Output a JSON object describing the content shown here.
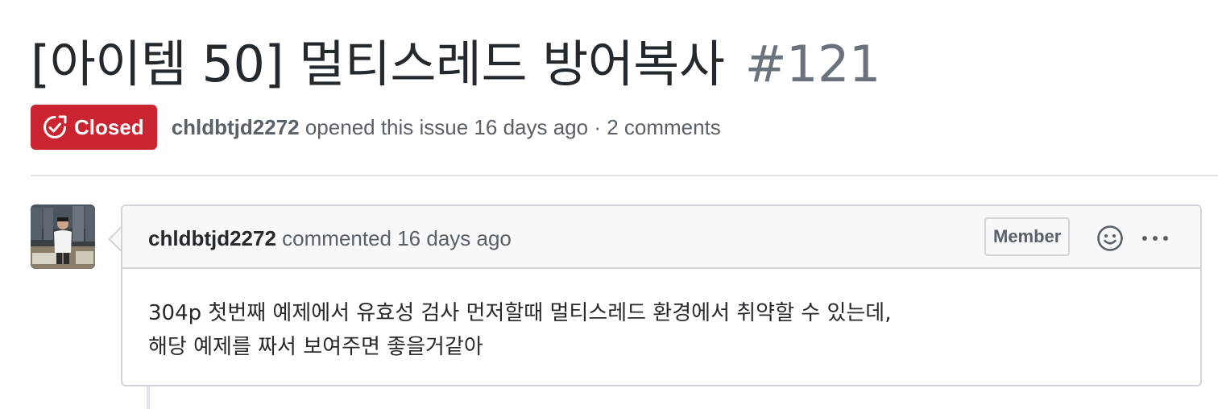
{
  "issue": {
    "title": "[아이템 50] 멀티스레드 방어복사",
    "number": "#121",
    "state": "Closed",
    "state_color": "#cb2431",
    "state_icon": "issue-closed-icon",
    "author": "chldbtjd2272",
    "meta_suffix": " opened this issue 16 days ago · 2 comments"
  },
  "comment": {
    "author": "chldbtjd2272",
    "action_text": " commented 16 days ago",
    "role_badge": "Member",
    "reaction_icon": "smiley-icon",
    "more_icon": "kebab-horizontal-icon",
    "body_lines": [
      "304p 첫번째 예제에서 유효성 검사 먼저할때 멀티스레드 환경에서 취약할 수 있는데,",
      "해당 예제를 짜서 보여주면 좋을거같아"
    ]
  }
}
